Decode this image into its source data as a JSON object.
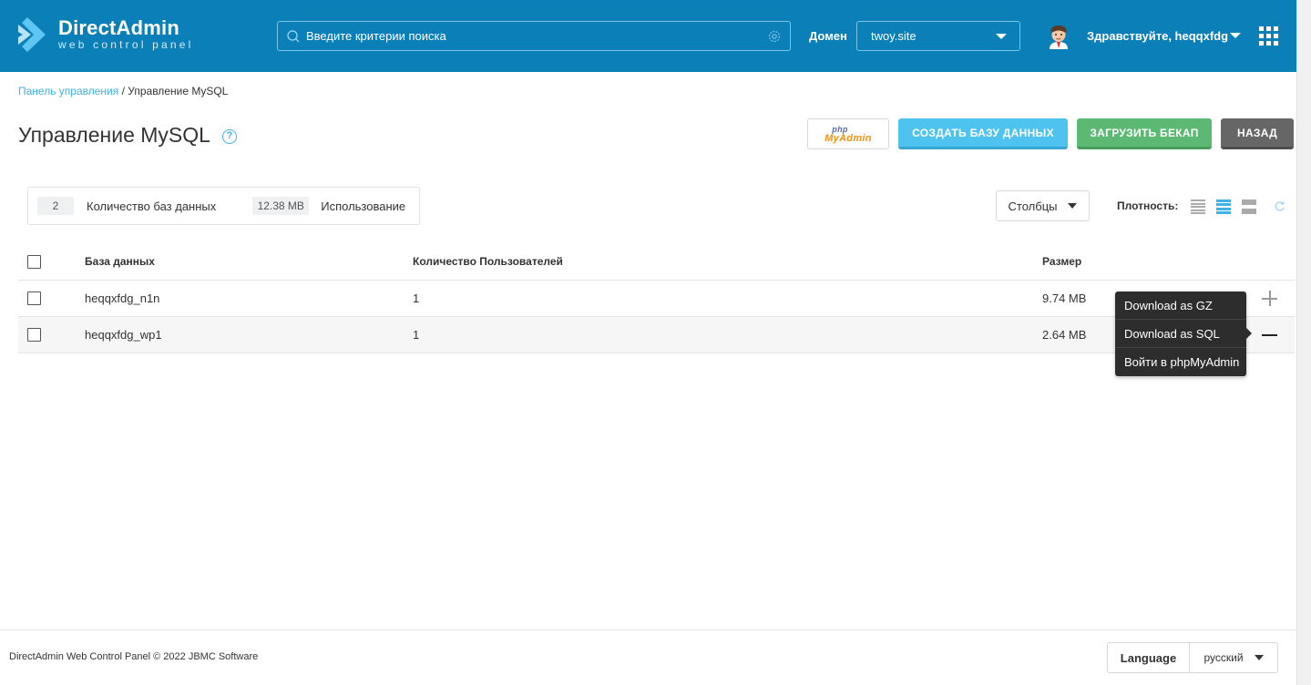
{
  "app": {
    "logo_title": "DirectAdmin",
    "logo_subtitle": "web control panel",
    "accent_color": "#0a7fb8"
  },
  "header": {
    "search_placeholder": "Введите критерии поиска",
    "domain_label": "Домен",
    "domain_value": "twoy.site",
    "greeting": "Здравствуйте, heqqxfdg"
  },
  "breadcrumb": {
    "link": "Панель управления",
    "separator": "/",
    "current": "Управление MySQL"
  },
  "page": {
    "title": "Управление MySQL",
    "help": "?"
  },
  "actions": {
    "pma_php": "php",
    "pma_myadmin": "MyAdmin",
    "create": "СОЗДАТЬ БАЗУ ДАННЫХ",
    "upload": "ЗАГРУЗИТЬ БЕКАП",
    "back": "НАЗАД"
  },
  "stats": {
    "db_count": "2",
    "db_count_label": "Количество баз данных",
    "usage": "12.38 MB",
    "usage_label": "Использование"
  },
  "toolbar": {
    "columns": "Столбцы",
    "density_label": "Плотность:"
  },
  "table": {
    "headers": {
      "database": "База данных",
      "users": "Количество Пользователей",
      "size": "Размер"
    },
    "rows": [
      {
        "name": "heqqxfdg_n1n",
        "users": "1",
        "size": "9.74 MB"
      },
      {
        "name": "heqqxfdg_wp1",
        "users": "1",
        "size": "2.64 MB"
      }
    ]
  },
  "context_menu": {
    "items": [
      "Download as GZ",
      "Download as SQL",
      "Войти в phpMyAdmin"
    ]
  },
  "footer": {
    "copyright": "DirectAdmin Web Control Panel © 2022 JBMC Software",
    "language_label": "Language",
    "language_value": "русский"
  }
}
